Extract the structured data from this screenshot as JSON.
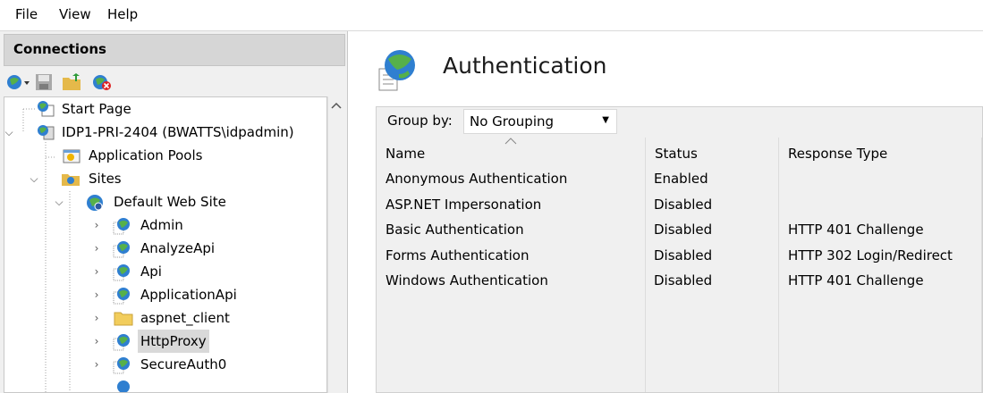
{
  "menu": {
    "items": [
      "File",
      "View",
      "Help"
    ]
  },
  "connections": {
    "title": "Connections",
    "toolbar_icons": [
      "connect-icon",
      "save-icon",
      "up-folder-icon",
      "disconnect-icon"
    ],
    "tree": [
      {
        "label": "Start Page",
        "icon": "start-page-icon"
      },
      {
        "label": "IDP1-PRI-2404 (BWATTS\\idpadmin)",
        "icon": "server-icon"
      },
      {
        "label": "Application Pools",
        "icon": "app-pools-icon"
      },
      {
        "label": "Sites",
        "icon": "sites-folder-icon"
      },
      {
        "label": "Default Web Site",
        "icon": "website-globe-icon"
      },
      {
        "label": "Admin",
        "icon": "web-app-icon"
      },
      {
        "label": "AnalyzeApi",
        "icon": "web-app-icon"
      },
      {
        "label": "Api",
        "icon": "web-app-icon"
      },
      {
        "label": "ApplicationApi",
        "icon": "web-app-icon"
      },
      {
        "label": "aspnet_client",
        "icon": "folder-icon"
      },
      {
        "label": "HttpProxy",
        "icon": "web-app-icon"
      },
      {
        "label": "SecureAuth0",
        "icon": "web-app-icon"
      }
    ],
    "selected": "HttpProxy"
  },
  "main": {
    "title": "Authentication",
    "group_by_label": "Group by:",
    "group_by_value": "No Grouping",
    "columns": [
      "Name",
      "Status",
      "Response Type"
    ],
    "rows": [
      {
        "name": "Anonymous Authentication",
        "status": "Enabled",
        "response": ""
      },
      {
        "name": "ASP.NET Impersonation",
        "status": "Disabled",
        "response": ""
      },
      {
        "name": "Basic Authentication",
        "status": "Disabled",
        "response": "HTTP 401 Challenge"
      },
      {
        "name": "Forms Authentication",
        "status": "Disabled",
        "response": "HTTP 302 Login/Redirect"
      },
      {
        "name": "Windows Authentication",
        "status": "Disabled",
        "response": "HTTP 401 Challenge"
      }
    ]
  }
}
